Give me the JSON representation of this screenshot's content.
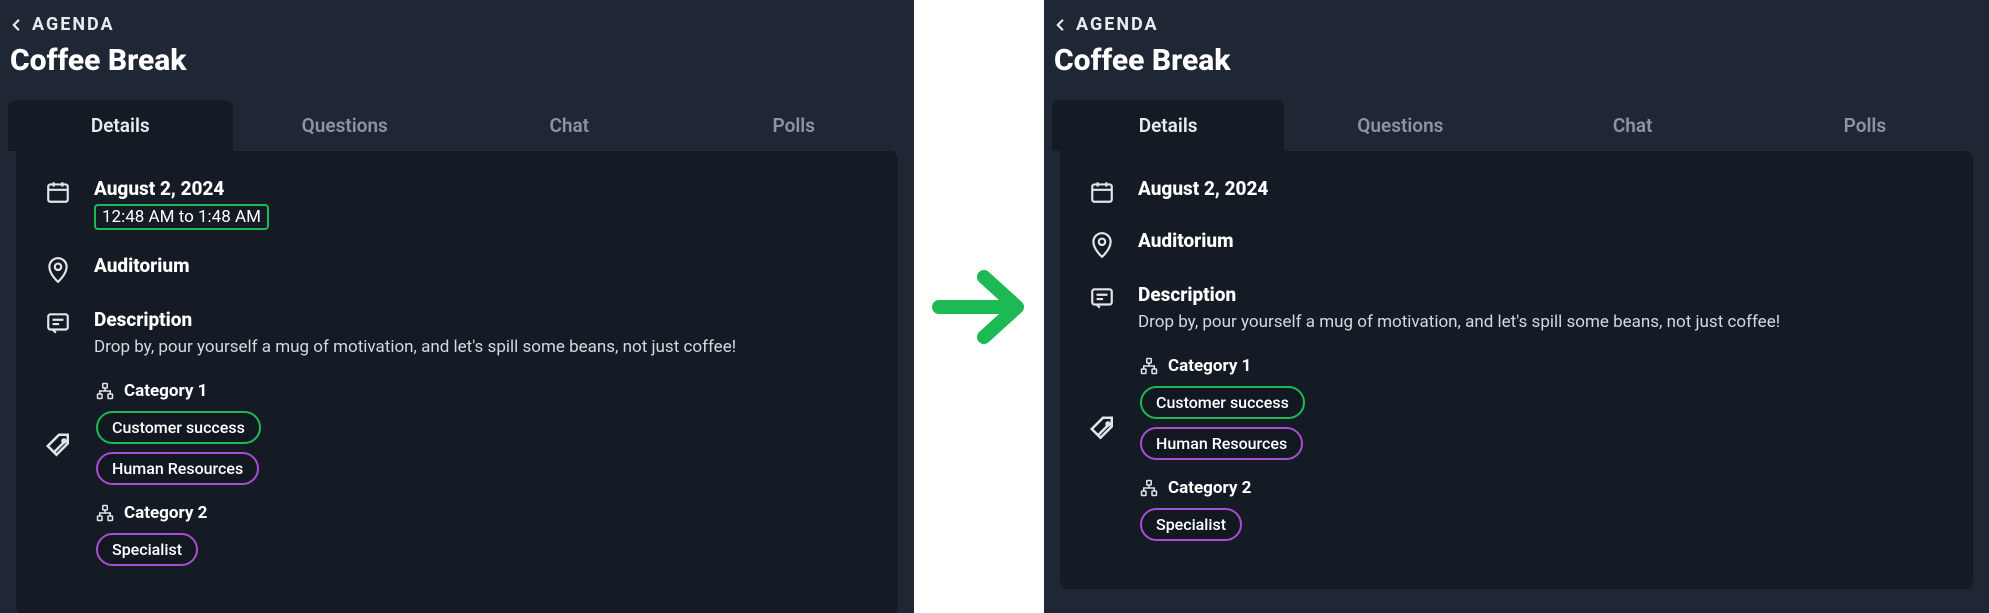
{
  "common": {
    "back_label": "AGENDA",
    "title": "Coffee Break",
    "tabs": [
      "Details",
      "Questions",
      "Chat",
      "Polls"
    ],
    "date": "August 2, 2024",
    "time_range": "12:48 AM to 1:48 AM",
    "location": "Auditorium",
    "description_label": "Description",
    "description_text": "Drop by, pour yourself a mug of motivation, and let's spill some beans, not just coffee!",
    "category1_label": "Category 1",
    "category2_label": "Category 2",
    "pill_customer_success": "Customer success",
    "pill_human_resources": "Human Resources",
    "pill_specialist": "Specialist"
  },
  "colors": {
    "accent_green": "#1db954",
    "accent_purple": "#a84dd4",
    "panel_bg": "#1e2733",
    "content_bg": "#141b24"
  }
}
